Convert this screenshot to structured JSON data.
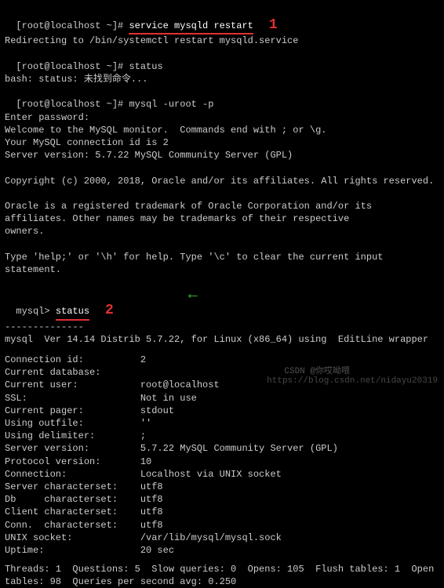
{
  "prompt1": {
    "user": "[root@localhost ~]# ",
    "cmd": "service mysqld restart"
  },
  "annotation1": "1",
  "lines_after_restart": [
    "Redirecting to /bin/systemctl restart mysqld.service"
  ],
  "prompt2": {
    "user": "[root@localhost ~]# ",
    "cmd": "status"
  },
  "status_error": "bash: status: 未找到命令...",
  "prompt3": {
    "user": "[root@localhost ~]# ",
    "cmd": "mysql -uroot -p"
  },
  "mysql_intro": [
    "Enter password:",
    "Welcome to the MySQL monitor.  Commands end with ; or \\g.",
    "Your MySQL connection id is 2",
    "Server version: 5.7.22 MySQL Community Server (GPL)",
    "",
    "Copyright (c) 2000, 2018, Oracle and/or its affiliates. All rights reserved.",
    "",
    "Oracle is a registered trademark of Oracle Corporation and/or its",
    "affiliates. Other names may be trademarks of their respective",
    "owners.",
    "",
    "Type 'help;' or '\\h' for help. Type '\\c' to clear the current input statement.",
    ""
  ],
  "mysql_prompt": {
    "user": "mysql> ",
    "cmd": "status"
  },
  "annotation2": "2",
  "divider": "--------------",
  "version_line": "mysql  Ver 14.14 Distrib 5.7.22, for Linux (x86_64) using  EditLine wrapper",
  "status_kv": [
    {
      "k": "Connection id:",
      "v": "2"
    },
    {
      "k": "Current database:",
      "v": ""
    },
    {
      "k": "Current user:",
      "v": "root@localhost"
    },
    {
      "k": "SSL:",
      "v": "Not in use"
    },
    {
      "k": "Current pager:",
      "v": "stdout"
    },
    {
      "k": "Using outfile:",
      "v": "''"
    },
    {
      "k": "Using delimiter:",
      "v": ";"
    },
    {
      "k": "Server version:",
      "v": "5.7.22 MySQL Community Server (GPL)"
    },
    {
      "k": "Protocol version:",
      "v": "10"
    },
    {
      "k": "Connection:",
      "v": "Localhost via UNIX socket"
    },
    {
      "k": "Server characterset:",
      "v": "utf8"
    },
    {
      "k": "Db     characterset:",
      "v": "utf8"
    },
    {
      "k": "Client characterset:",
      "v": "utf8"
    },
    {
      "k": "Conn.  characterset:",
      "v": "utf8"
    },
    {
      "k": "UNIX socket:",
      "v": "/var/lib/mysql/mysql.sock"
    },
    {
      "k": "Uptime:",
      "v": "20 sec"
    }
  ],
  "footer_stats": "Threads: 1  Questions: 5  Slow queries: 0  Opens: 105  Flush tables: 1  Open tables: 98  Queries per second avg: 0.250",
  "watermark_text": "https://blog.csdn.net/nidayu20319",
  "watermark_text2": "CSDN @你哎呦喂"
}
